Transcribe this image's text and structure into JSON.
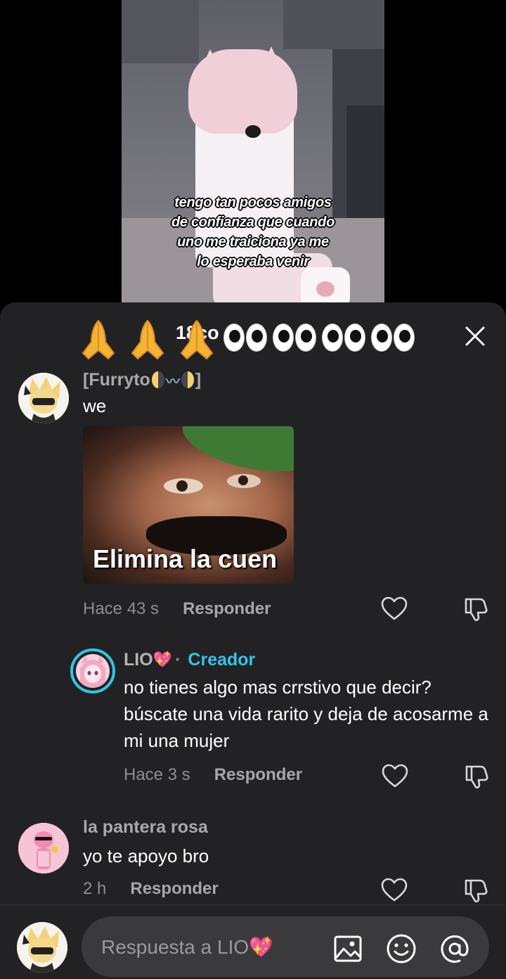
{
  "video": {
    "caption": "tengo tan pocos amigos\nde confianza que cuando\nuno me traiciona ya me\nlo esperaba venir"
  },
  "header": {
    "title_prefix": "18",
    "title_suffix": "co",
    "overlay_emoji": "🙏🙏🙏👀👀👀👀"
  },
  "comments": [
    {
      "username": "[Furryto ",
      "username_suffix": "]",
      "username_emoji": "🌗〰️🌓",
      "text": "we",
      "sticker_caption": "Elimina la cuen",
      "time": "Hace 43 s",
      "reply_label": "Responder"
    },
    {
      "username": "LIO",
      "username_emoji": "💖",
      "separator": "·",
      "badge": "Creador",
      "text": "no tienes algo mas crrstivo que decir? búscate una vida rarito y deja de acosarme a mi una mujer",
      "time": "Hace 3 s",
      "reply_label": "Responder"
    },
    {
      "username": "la pantera rosa",
      "text": "yo te apoyo bro",
      "time": "2 h",
      "reply_label": "Responder"
    }
  ],
  "input": {
    "placeholder": "Respuesta a LIO💖"
  },
  "colors": {
    "sheet_bg": "#222224",
    "creator_badge": "#33c5e6",
    "input_bg": "#3a3a3d"
  },
  "icons": [
    "close-icon",
    "heart-icon",
    "dislike-icon",
    "image-icon",
    "emoji-icon",
    "mention-icon",
    "pray-emoji",
    "eyes-emoji"
  ]
}
